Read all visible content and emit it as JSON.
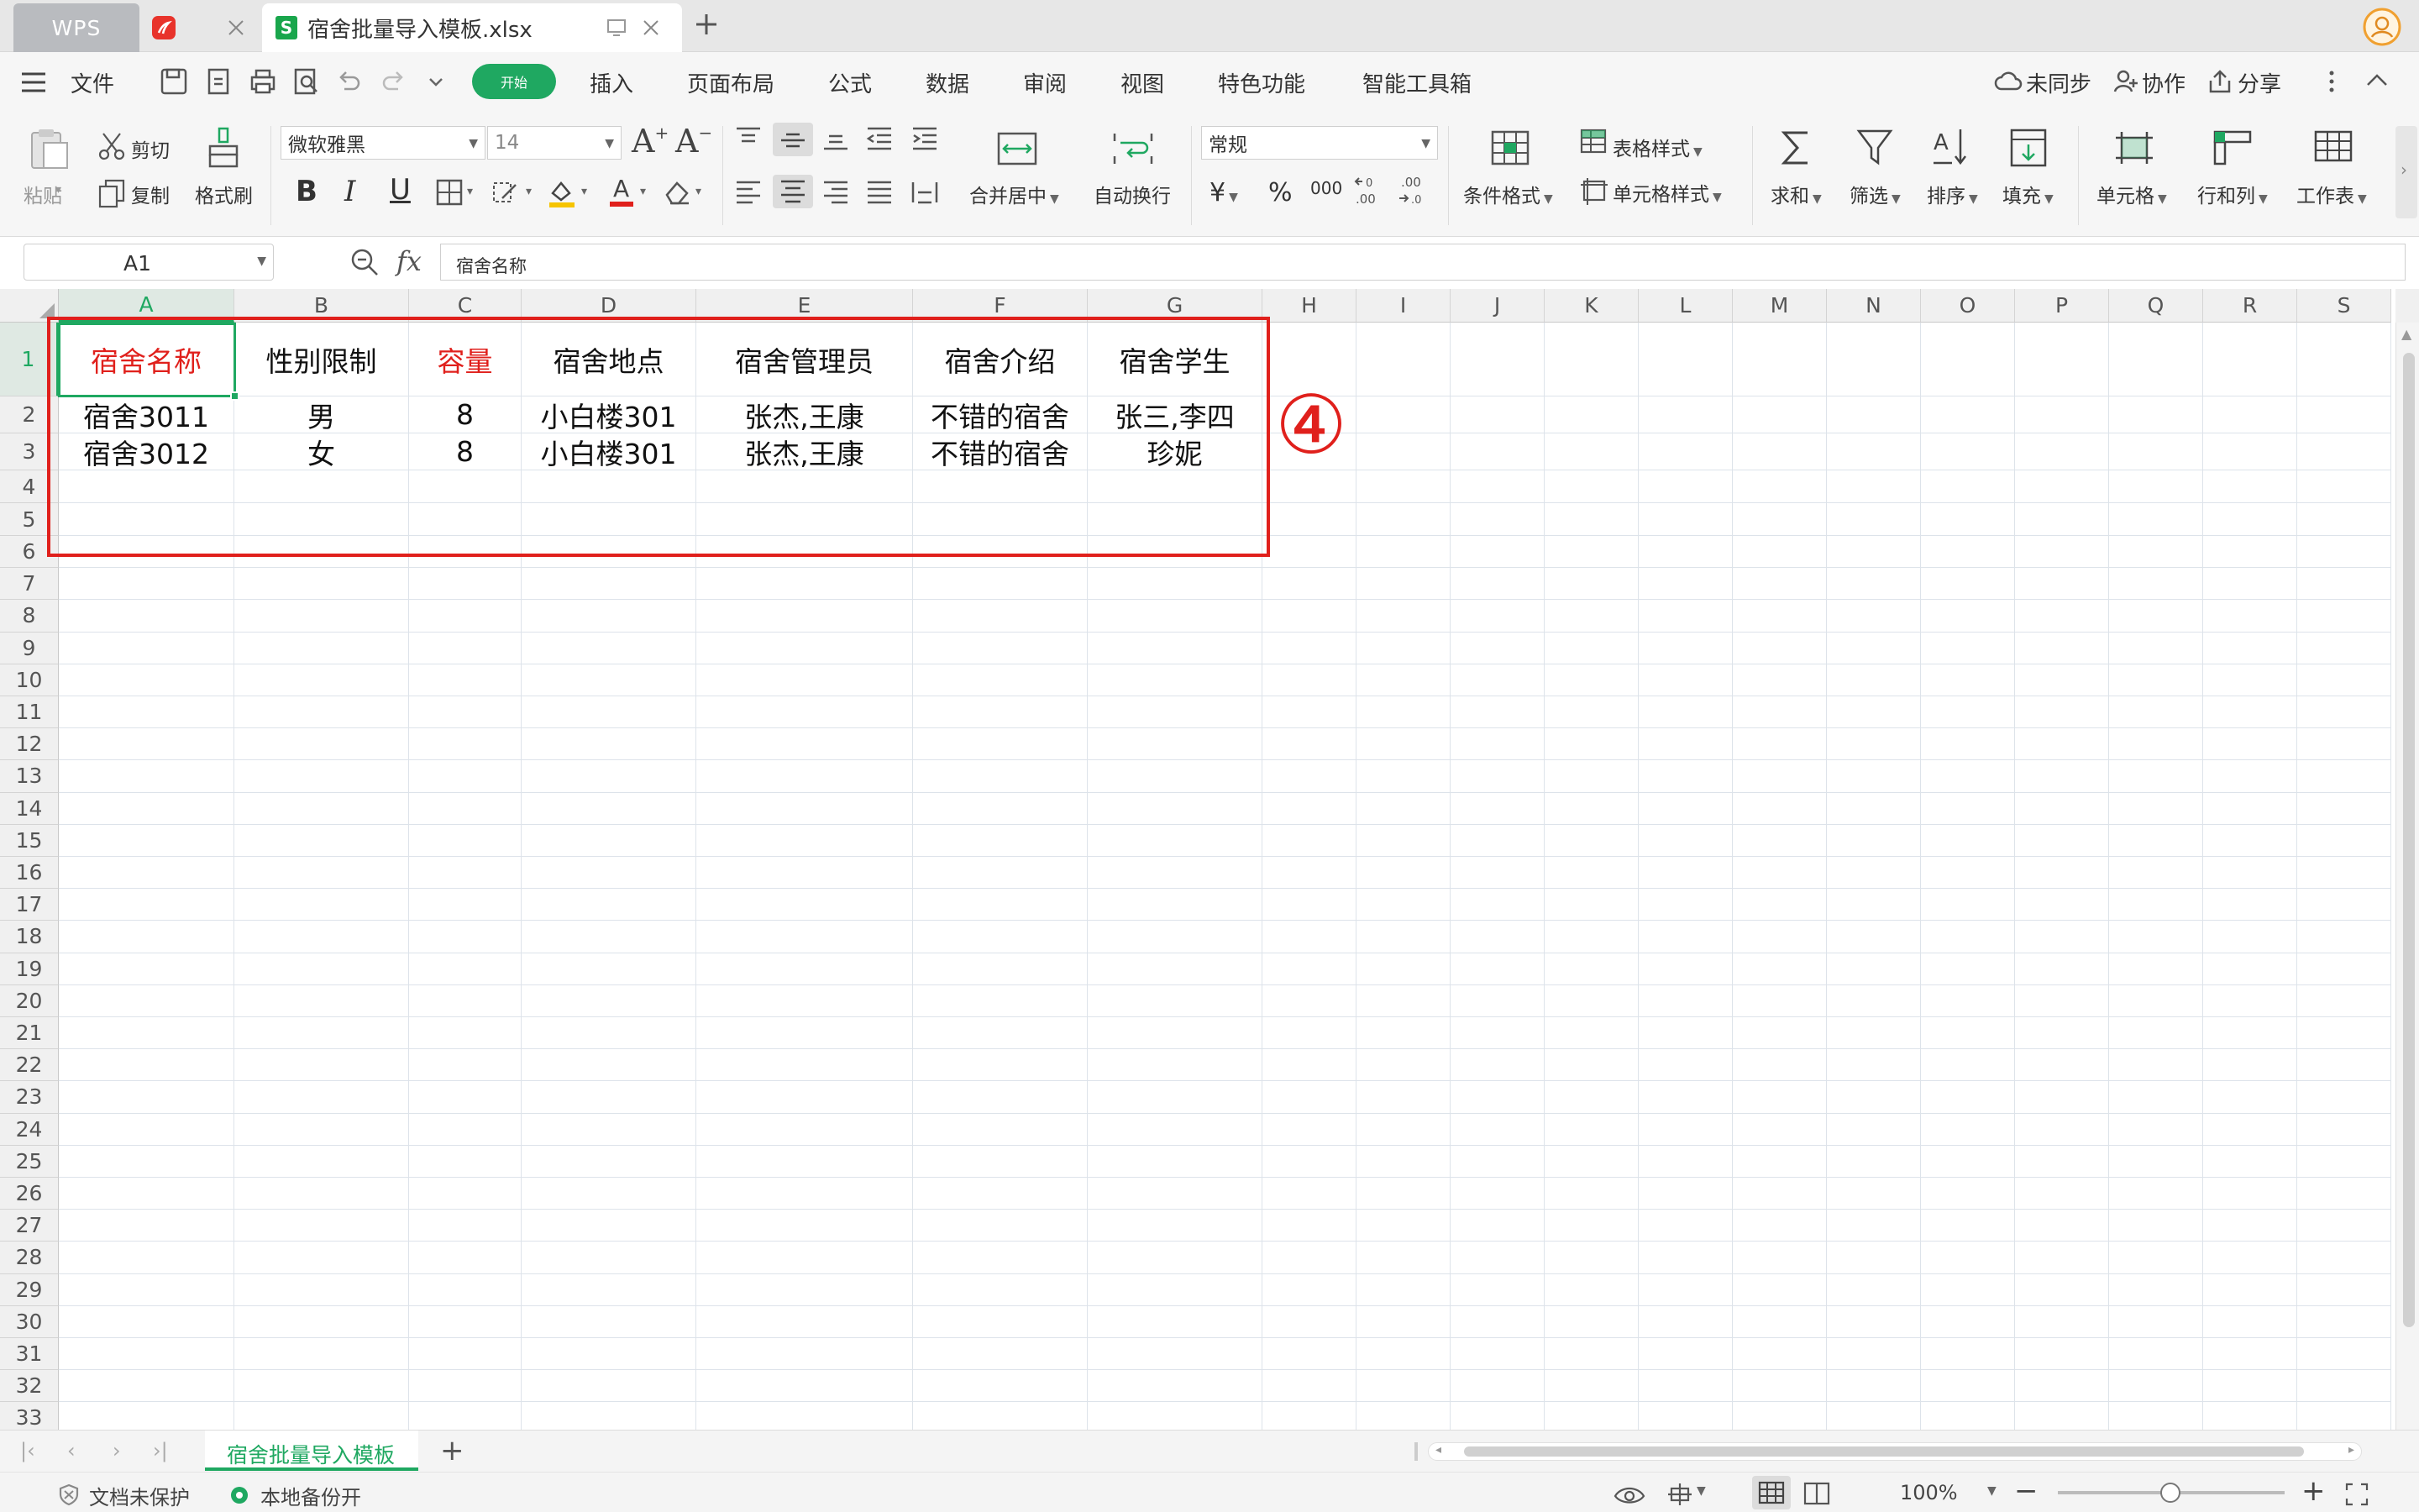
{
  "tabs": {
    "wps": "WPS",
    "file": "宿舍批量导入模板.xlsx"
  },
  "menu": {
    "file": "文件",
    "items": [
      "开始",
      "插入",
      "页面布局",
      "公式",
      "数据",
      "审阅",
      "视图",
      "特色功能",
      "智能工具箱"
    ],
    "sync": "未同步",
    "collab": "协作",
    "share": "分享"
  },
  "ribbon": {
    "paste": "粘贴",
    "cut": "剪切",
    "copy": "复制",
    "format_painter": "格式刷",
    "font_name": "微软雅黑",
    "font_size": "14",
    "merge_center": "合并居中",
    "wrap": "自动换行",
    "number_format": "常规",
    "cond_format": "条件格式",
    "table_style": "表格样式",
    "cell_style": "单元格样式",
    "sum": "求和",
    "filter": "筛选",
    "sort": "排序",
    "fill": "填充",
    "cell": "单元格",
    "row_col": "行和列",
    "worksheet": "工作表",
    "currency_symbol": "¥",
    "percent_symbol": "%",
    "thousands": "000"
  },
  "formula_bar": {
    "name_box": "A1",
    "fx": "fx",
    "content": "宿舍名称"
  },
  "columns": [
    "A",
    "B",
    "C",
    "D",
    "E",
    "F",
    "G",
    "H",
    "I",
    "J",
    "K",
    "L",
    "M",
    "N",
    "O",
    "P",
    "Q",
    "R",
    "S"
  ],
  "rows": [
    "1",
    "2",
    "3",
    "4",
    "5",
    "6",
    "7",
    "8",
    "9",
    "10",
    "11",
    "12",
    "13",
    "14",
    "15",
    "16",
    "17",
    "18",
    "19",
    "20",
    "21",
    "22",
    "23",
    "24",
    "25",
    "26",
    "27",
    "28",
    "29",
    "30",
    "31",
    "32",
    "33"
  ],
  "sheet": {
    "headers": [
      "宿舍名称",
      "性别限制",
      "容量",
      "宿舍地点",
      "宿舍管理员",
      "宿舍介绍",
      "宿舍学生"
    ],
    "required_color": "#e0201c",
    "data": [
      [
        "宿舍3011",
        "男",
        "8",
        "小白楼301",
        "张杰,王康",
        "不错的宿舍",
        "张三,李四"
      ],
      [
        "宿舍3012",
        "女",
        "8",
        "小白楼301",
        "张杰,王康",
        "不错的宿舍",
        "珍妮"
      ]
    ]
  },
  "annotation": {
    "label": "④",
    "color": "#e0201c"
  },
  "sheet_tabs": {
    "active": "宿舍批量导入模板",
    "add": "+"
  },
  "status": {
    "protect": "文档未保护",
    "backup": "本地备份开",
    "zoom": "100%",
    "minus": "−",
    "plus": "+"
  },
  "colors": {
    "accent": "#1fa861",
    "red": "#e0201c"
  }
}
